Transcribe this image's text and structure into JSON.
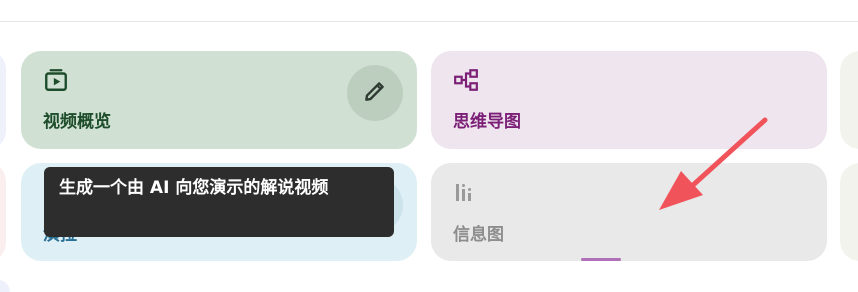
{
  "cards": {
    "video_overview": {
      "label": "视频概览",
      "icon": "video-play-icon",
      "color": "#1e4d2b",
      "background": "#d0e0d3",
      "action_icon": "pencil-edit-icon"
    },
    "mind_map": {
      "label": "思维导图",
      "icon": "mind-map-icon",
      "color": "#7b1f77",
      "background": "#efe5ef"
    },
    "report": {
      "label": "演拉",
      "color": "#2a6f96",
      "background": "#def0f6"
    },
    "infographic": {
      "label": "信息图",
      "icon": "bar-chart-icon",
      "color": "#8d8d8d",
      "background": "#e9e9e9"
    }
  },
  "tooltip": {
    "text": "生成一个由 AI 向您演示的解说视频"
  },
  "annotation": {
    "type": "red-arrow",
    "color": "#f0545a"
  }
}
